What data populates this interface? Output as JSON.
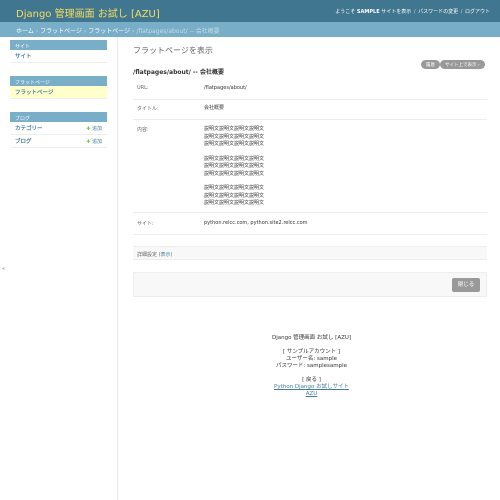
{
  "header": {
    "site_name": "Django 管理画面 お試し [AZU]",
    "welcome": "ようこそ",
    "username": "SAMPLE",
    "view_site": "サイトを表示",
    "change_password": "パスワードの変更",
    "logout": "ログアウト",
    "separator": "/"
  },
  "breadcrumbs": {
    "home": "ホーム",
    "app": "フラットページ",
    "model": "フラットページ",
    "object": "/flatpages/about/ -- 会社概要",
    "sep": "›"
  },
  "sidebar": {
    "modules": [
      {
        "caption": "サイト",
        "rows": [
          {
            "name": "サイト"
          }
        ]
      },
      {
        "caption": "フラットページ",
        "rows": [
          {
            "name": "フラットページ"
          }
        ]
      },
      {
        "caption": "ブログ",
        "rows": [
          {
            "name": "カテゴリー",
            "add": "追加"
          },
          {
            "name": "ブログ",
            "add": "追加"
          }
        ]
      }
    ],
    "toggle": "«"
  },
  "content": {
    "page_title": "フラットページを表示",
    "object_title": "/flatpages/about/ -- 会社概要",
    "history_button": "履歴",
    "view_on_site_button": "サイト上で表示 ›",
    "fields": {
      "url_label": "URL:",
      "url_value": "/flatpages/about/",
      "title_label": "タイトル:",
      "title_value": "会社概要",
      "content_label": "内容:",
      "content_lines": [
        "説明文説明文説明文説明文",
        "説明文説明文説明文説明文",
        "説明文説明文説明文説明文",
        "説明文説明文説明文説明文",
        "説明文説明文説明文説明文",
        "説明文説明文説明文説明文",
        "説明文説明文説明文説明文",
        "説明文説明文説明文説明文",
        "説明文説明文説明文説明文"
      ],
      "sites_label": "サイト:",
      "sites_value": "python.relcc.com, python.site2.relcc.com"
    },
    "advanced_label": "詳細設定",
    "advanced_toggle": "(表示)",
    "close_button": "閉じる"
  },
  "footer": {
    "title": "Django 管理画面 お試し [AZU]",
    "account_heading": "[ サンプルアカウント ]",
    "username_line": "ユーザー名: sample",
    "password_line": "パスワード: samplesample",
    "back_label": "[ 戻る ]",
    "back_link_1": "Python Django お試しサイト",
    "back_link_2": "AZU"
  },
  "colors": {
    "header_bg": "#417690",
    "breadcrumb_bg": "#79aec8",
    "site_name": "#f5dd5d",
    "link": "#447e9b",
    "active_row": "#ffffcc",
    "add_icon": "#70bf2b"
  }
}
